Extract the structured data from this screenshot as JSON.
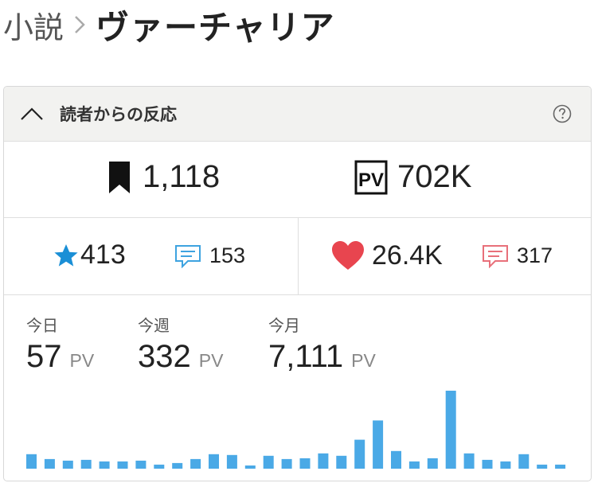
{
  "breadcrumb": {
    "root": "小説",
    "title": "ヴァーチャリア"
  },
  "panel": {
    "title": "読者からの反応"
  },
  "stats": {
    "bookmarks": "1,118",
    "pv_total": "702K",
    "stars": "413",
    "reviews": "153",
    "likes": "26.4K",
    "comments": "317"
  },
  "pv": {
    "unit": "PV",
    "today": {
      "label": "今日",
      "value": "57"
    },
    "week": {
      "label": "今週",
      "value": "332"
    },
    "month": {
      "label": "今月",
      "value": "7,111"
    }
  },
  "colors": {
    "star": "#1a8fd6",
    "heart": "#e8454f",
    "bar": "#4aa9e6",
    "comment_red": "#e8707a",
    "comment_blue": "#3ea3e0"
  },
  "icons": [
    "chevron-up-icon",
    "help-icon",
    "bookmark-icon",
    "pv-icon",
    "star-icon",
    "review-icon",
    "heart-icon",
    "comment-icon"
  ],
  "chart_data": {
    "type": "bar",
    "values": [
      18,
      12,
      10,
      11,
      9,
      9,
      10,
      5,
      7,
      12,
      18,
      17,
      4,
      16,
      12,
      13,
      19,
      16,
      36,
      60,
      22,
      9,
      13,
      97,
      19,
      11,
      9,
      18,
      5,
      5
    ]
  }
}
